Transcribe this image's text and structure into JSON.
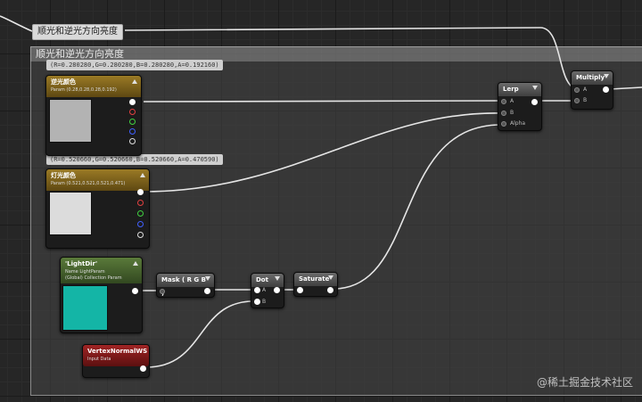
{
  "comment": {
    "tag": "顺光和逆光方向亮度",
    "title": "顺光和逆光方向亮度"
  },
  "param_labels": {
    "back": "(R=0.280280,G=0.280280,B=0.280280,A=0.192160)",
    "light": "(R=0.520660,G=0.520660,B=0.520660,A=0.470590)"
  },
  "nodes": {
    "back_color": {
      "title": "逆光颜色",
      "sub": "Param (0.28,0.28,0.28,0.192)",
      "color": "#b3b3b3"
    },
    "light_color": {
      "title": "灯光颜色",
      "sub": "Param (0.521,0.521,0.521,0.471)",
      "color": "#dcdcdc"
    },
    "light_dir": {
      "title": "'LightDir'",
      "sub1": "Name LightParam",
      "sub2": "(Global) Collection Param",
      "color": "#14b5a6"
    },
    "vertex_normal": {
      "title": "VertexNormalWS",
      "sub": "Input Data"
    },
    "mask": {
      "title": "Mask ( R G B )"
    },
    "dot": {
      "title": "Dot",
      "pin_a": "A",
      "pin_b": "B"
    },
    "saturate": {
      "title": "Saturate"
    },
    "lerp": {
      "title": "Lerp",
      "pin_a": "A",
      "pin_b": "B",
      "pin_alpha": "Alpha"
    },
    "multiply": {
      "title": "Multiply",
      "pin_a": "A",
      "pin_b": "B"
    }
  },
  "watermark": "@稀土掘金技术社区",
  "colors": {
    "gold_header": "#8a6a1f",
    "green_header": "#4a6a30",
    "red_header": "#8c1a1a",
    "wire": "#e6e6e6"
  }
}
